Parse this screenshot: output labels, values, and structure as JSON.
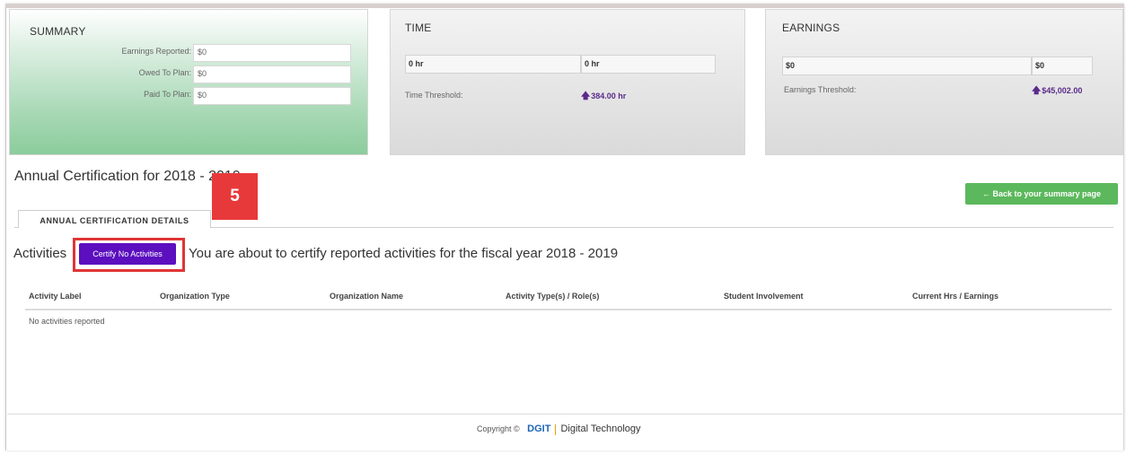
{
  "summary": {
    "title": "SUMMARY",
    "rows": [
      {
        "label": "Earnings Reported:",
        "value": "$0"
      },
      {
        "label": "Owed To Plan:",
        "value": "$0"
      },
      {
        "label": "Paid To Plan:",
        "value": "$0"
      }
    ]
  },
  "time": {
    "title": "TIME",
    "field1": "0 hr",
    "field2": "0 hr",
    "threshold_label": "Time Threshold:",
    "threshold_value": "384.00 hr"
  },
  "earnings": {
    "title": "EARNINGS",
    "field1": "$0",
    "field2": "$0",
    "threshold_label": "Earnings Threshold:",
    "threshold_value": "$45,002.00"
  },
  "page": {
    "title": "Annual Certification for 2018 - 2019",
    "back_button": "← Back to your summary page",
    "tab_label": "ANNUAL CERTIFICATION DETAILS",
    "step_badge": "5"
  },
  "activities": {
    "label": "Activities",
    "certify_button": "Certify No Activities",
    "message": "You are about to certify reported activities for the fiscal year 2018 - 2019",
    "columns": [
      "Activity Label",
      "Organization Type",
      "Organization Name",
      "Activity Type(s) / Role(s)",
      "Student Involvement",
      "Current Hrs / Earnings"
    ],
    "empty_text": "No activities reported"
  },
  "footer": {
    "copyright": "Copyright ©",
    "brand": "DGIT",
    "company": "Digital Technology"
  },
  "colors": {
    "summary_green": "#8bcc9c",
    "certify_purple": "#5b0fbf",
    "back_green": "#5cb85c",
    "badge_red": "#e8393a",
    "threshold_purple": "#5a2a8a"
  }
}
